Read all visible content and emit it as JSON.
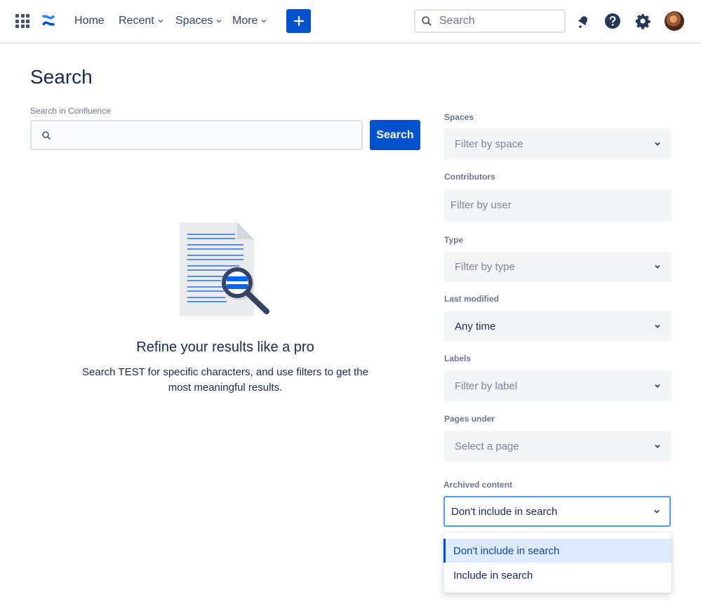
{
  "nav": {
    "home": "Home",
    "recent": "Recent",
    "spaces": "Spaces",
    "more": "More",
    "search_placeholder": "Search",
    "icons": [
      "app-switcher-icon",
      "confluence-logo",
      "plus-icon",
      "search-icon",
      "notifications-icon",
      "help-icon",
      "settings-icon",
      "avatar"
    ]
  },
  "page": {
    "title": "Search",
    "search_label": "Search in Confluence",
    "search_value": "",
    "search_button": "Search"
  },
  "empty_state": {
    "title": "Refine your results like a pro",
    "description": "Search TEST for specific characters, and use filters to get the most meaningful results."
  },
  "filters": {
    "spaces": {
      "label": "Spaces",
      "value": "Filter by space"
    },
    "contributors": {
      "label": "Contributors",
      "value": "Filter by user"
    },
    "type": {
      "label": "Type",
      "value": "Filter by type"
    },
    "last_modified": {
      "label": "Last modified",
      "value": "Any time"
    },
    "labels": {
      "label": "Labels",
      "value": "Filter by label"
    },
    "pages_under": {
      "label": "Pages under",
      "value": "Select a page"
    },
    "archived": {
      "label": "Archived content",
      "value": "Don't include in search",
      "options": [
        "Don't include in search",
        "Include in search"
      ]
    }
  },
  "colors": {
    "brand": "#0052cc",
    "text": "#172b4d",
    "subtle": "#6b778c",
    "field_bg": "#f4f5f7",
    "focus": "#4c9aff",
    "selected_bg": "#deebff"
  }
}
